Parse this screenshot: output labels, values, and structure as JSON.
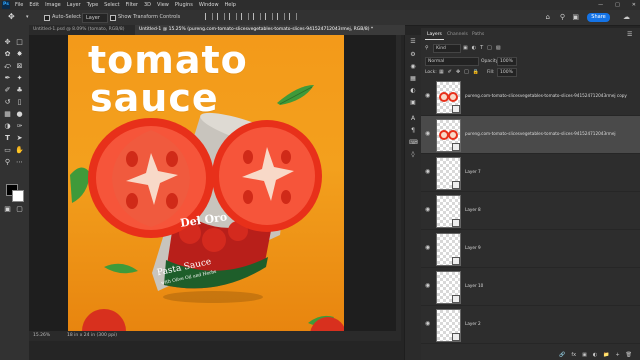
{
  "menubar": {
    "logo": "Ps",
    "menus": [
      "File",
      "Edit",
      "Image",
      "Layer",
      "Type",
      "Select",
      "Filter",
      "3D",
      "View",
      "Plugins",
      "Window",
      "Help"
    ]
  },
  "options_bar": {
    "auto_select_label": "Auto-Select",
    "auto_select_target": "Layer",
    "transform_label": "Show Transform Controls",
    "share_label": "Share"
  },
  "tabs": [
    {
      "label": "Untitled-1.psd @ 8.09% (tomato, RGB/8)",
      "active": false
    },
    {
      "label": "Untitled-1 @ 15.25% (pureng.com-tomato-slicesvegetables-tomato-slices-941524712043rmej, RGB/8) *",
      "active": true
    }
  ],
  "artwork": {
    "headline_line1": "tomato",
    "headline_line2": "sauce",
    "can_brand": "Del Oro",
    "can_title": "Pasta Sauce",
    "can_subtitle": "with Olive Oil and Herbs",
    "colors": {
      "background": "#f39a1a",
      "tomato": "#e8301a",
      "tomato_flesh": "#f6553a",
      "leaf": "#3f9a3a"
    }
  },
  "status": {
    "zoom": "15.26%",
    "doc_size": "18 in x 24 in (300 ppi)"
  },
  "layers_panel": {
    "tabs": [
      {
        "label": "Layers",
        "active": true
      },
      {
        "label": "Channels",
        "active": false
      },
      {
        "label": "Paths",
        "active": false
      }
    ],
    "filter_kind": "Kind",
    "blend_mode": "Normal",
    "opacity_label": "Opacity:",
    "opacity_value": "100%",
    "lock_label": "Lock:",
    "fill_label": "Fill:",
    "fill_value": "100%",
    "layers": [
      {
        "name": "pureng.com-tomato-slicesvegetables-tomato-slices-941524712043rmej copy",
        "selected": false,
        "has_tomato": true
      },
      {
        "name": "pureng.com-tomato-slicesvegetables-tomato-slices-941524712043rmej",
        "selected": true,
        "has_tomato": true
      },
      {
        "name": "Layer 7",
        "selected": false,
        "has_tomato": false
      },
      {
        "name": "Layer 8",
        "selected": false,
        "has_tomato": false
      },
      {
        "name": "Layer 9",
        "selected": false,
        "has_tomato": false
      },
      {
        "name": "Layer 10",
        "selected": false,
        "has_tomato": false
      },
      {
        "name": "Layer 2",
        "selected": false,
        "has_tomato": false
      }
    ]
  }
}
